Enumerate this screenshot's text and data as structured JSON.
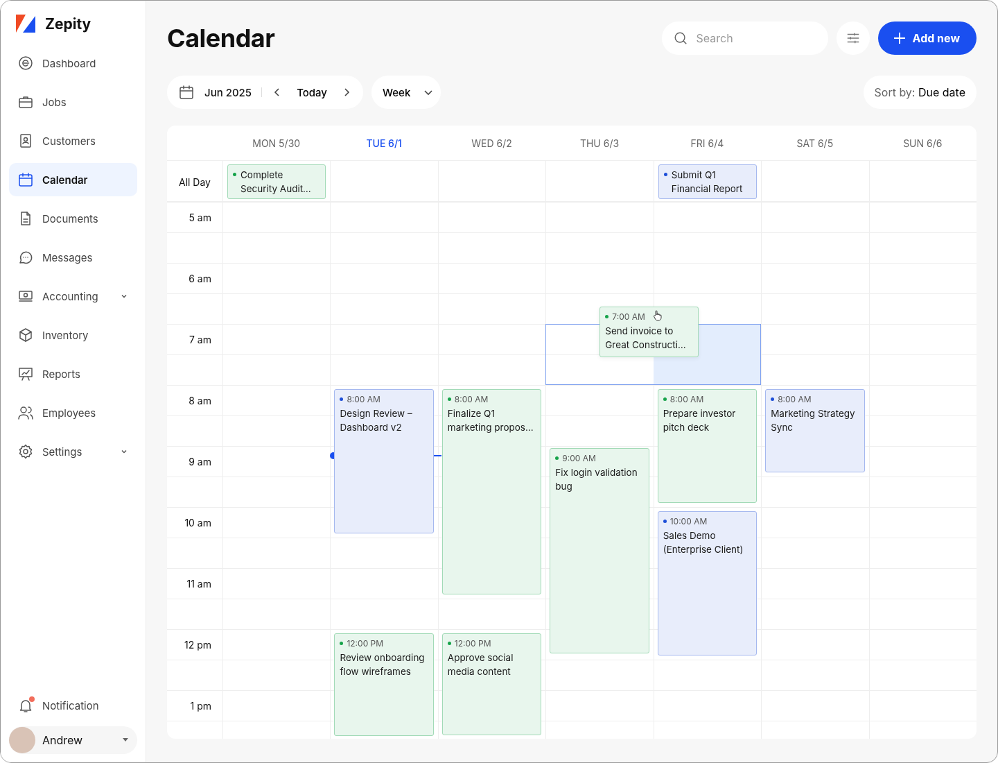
{
  "brand": "Zepity",
  "nav": [
    {
      "label": "Dashboard",
      "selected": false,
      "has_submenu": false
    },
    {
      "label": "Jobs",
      "selected": false,
      "has_submenu": false
    },
    {
      "label": "Customers",
      "selected": false,
      "has_submenu": false
    },
    {
      "label": "Calendar",
      "selected": true,
      "has_submenu": false
    },
    {
      "label": "Documents",
      "selected": false,
      "has_submenu": false
    },
    {
      "label": "Messages",
      "selected": false,
      "has_submenu": false
    },
    {
      "label": "Accounting",
      "selected": false,
      "has_submenu": true
    },
    {
      "label": "Inventory",
      "selected": false,
      "has_submenu": false
    },
    {
      "label": "Reports",
      "selected": false,
      "has_submenu": false
    },
    {
      "label": "Employees",
      "selected": false,
      "has_submenu": false
    },
    {
      "label": "Settings",
      "selected": false,
      "has_submenu": true
    }
  ],
  "notification": {
    "label": "Notification",
    "unread": true
  },
  "user": {
    "name": "Andrew"
  },
  "title": "Calendar",
  "search": {
    "placeholder": "Search"
  },
  "add_button": "Add new",
  "date_nav": {
    "month": "Jun 2025",
    "today": "Today"
  },
  "view": "Week",
  "sort": {
    "label": "Sort by:",
    "value": "Due date"
  },
  "all_day_label": "All Day",
  "hours": [
    "5 am",
    "6 am",
    "7 am",
    "8 am",
    "9 am",
    "10 am",
    "11 am",
    "12 pm",
    "1 pm"
  ],
  "days": [
    {
      "label": "MON 5/30",
      "selected": false,
      "all_day": [
        {
          "title": "Complete Security Audit…",
          "color": "#16a34a"
        }
      ]
    },
    {
      "label": "TUE 6/1",
      "selected": true,
      "events": [
        {
          "time": "8:00 AM",
          "title": "Design Review – Dashboard v2",
          "color": "#1d4ed8"
        },
        {
          "time": "12:00 PM",
          "title": "Review onboarding flow wireframes",
          "color": "#16a34a"
        }
      ]
    },
    {
      "label": "WED 6/2",
      "selected": false,
      "events": [
        {
          "time": "8:00 AM",
          "title": "Finalize Q1 marketing propos…",
          "color": "#16a34a"
        },
        {
          "time": "12:00 PM",
          "title": "Approve social media content",
          "color": "#16a34a"
        }
      ]
    },
    {
      "label": "THU 6/3",
      "selected": false,
      "events": [
        {
          "time": "9:00 AM",
          "title": "Fix login validation bug",
          "color": "#16a34a"
        }
      ]
    },
    {
      "label": "FRI 6/4",
      "selected": false,
      "all_day": [
        {
          "title": "Submit Q1 Financial Report",
          "color": "#1d4ed8"
        }
      ],
      "events": [
        {
          "time": "8:00 AM",
          "title": "Prepare investor pitch deck",
          "color": "#16a34a"
        },
        {
          "time": "10:00 AM",
          "title": "Sales Demo (Enterprise Client)",
          "color": "#1d4ed8"
        }
      ]
    },
    {
      "label": "SAT 6/5",
      "selected": false,
      "events": [
        {
          "time": "8:00 AM",
          "title": "Marketing Strategy Sync",
          "color": "#1d4ed8"
        }
      ]
    },
    {
      "label": "SUN 6/6",
      "selected": false
    }
  ],
  "drag_preview": {
    "time": "7:00 AM",
    "title": "Send invoice to Great Constructi…",
    "color": "#16a34a"
  }
}
